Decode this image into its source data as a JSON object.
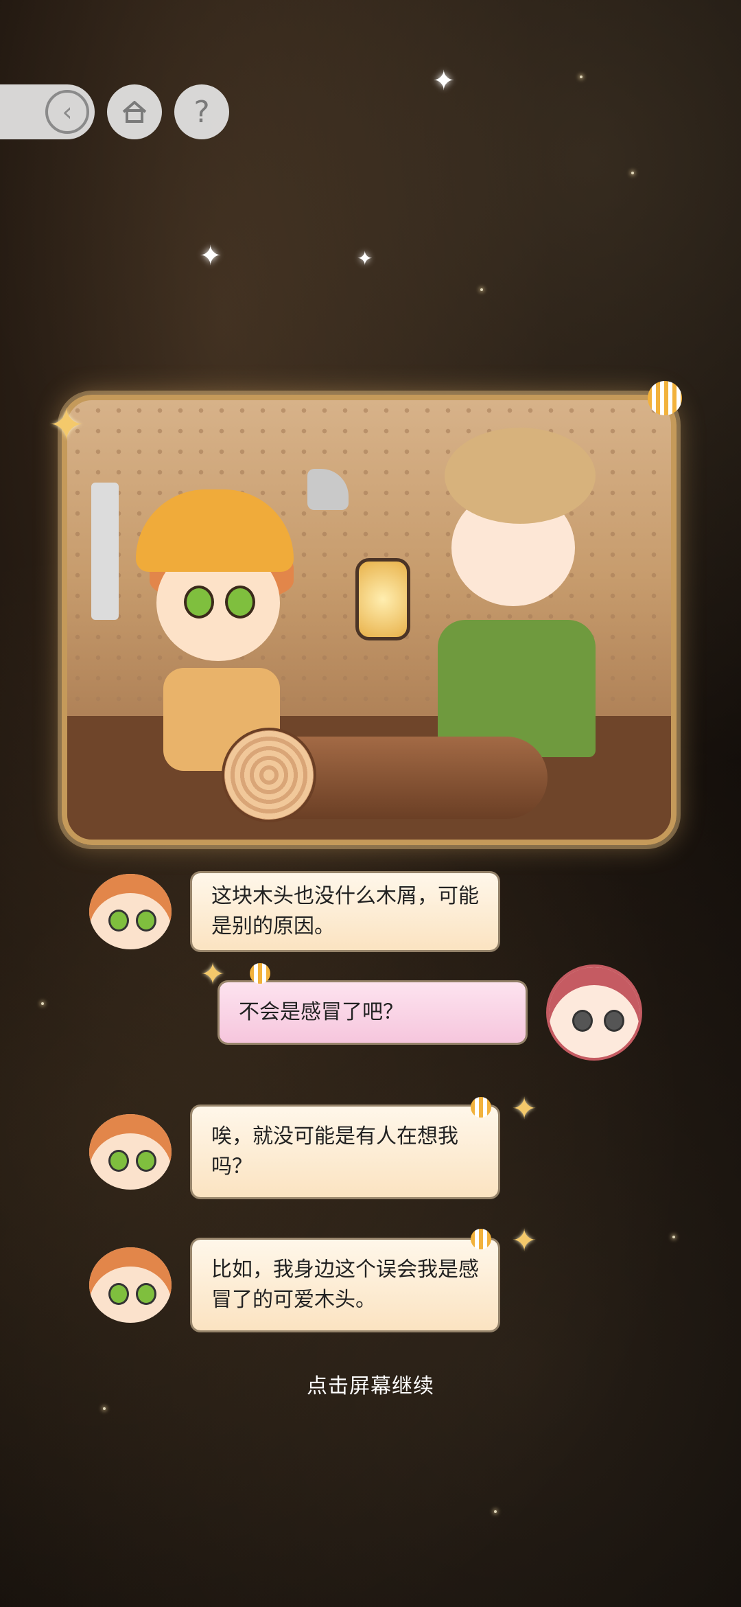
{
  "nav": {
    "back_icon": "back-circle-icon",
    "home_icon": "home-icon",
    "help_label": "?"
  },
  "messages": [
    {
      "speaker": "boy",
      "side": "left",
      "text": "这块木头也没什么木屑，可能是别的原因。"
    },
    {
      "speaker": "girl",
      "side": "right",
      "text": "不会是感冒了吧？"
    },
    {
      "speaker": "boy",
      "side": "left",
      "text": "唉，就没可能是有人在想我吗？"
    },
    {
      "speaker": "boy",
      "side": "left",
      "text": "比如，我身边这个误会我是感冒了的可爱木头。"
    }
  ],
  "footer": {
    "continue_hint": "点击屏幕继续"
  },
  "colors": {
    "card_border": "#c59a5a",
    "left_bubble": "#fbe3c1",
    "right_bubble": "#f6c6dd"
  }
}
